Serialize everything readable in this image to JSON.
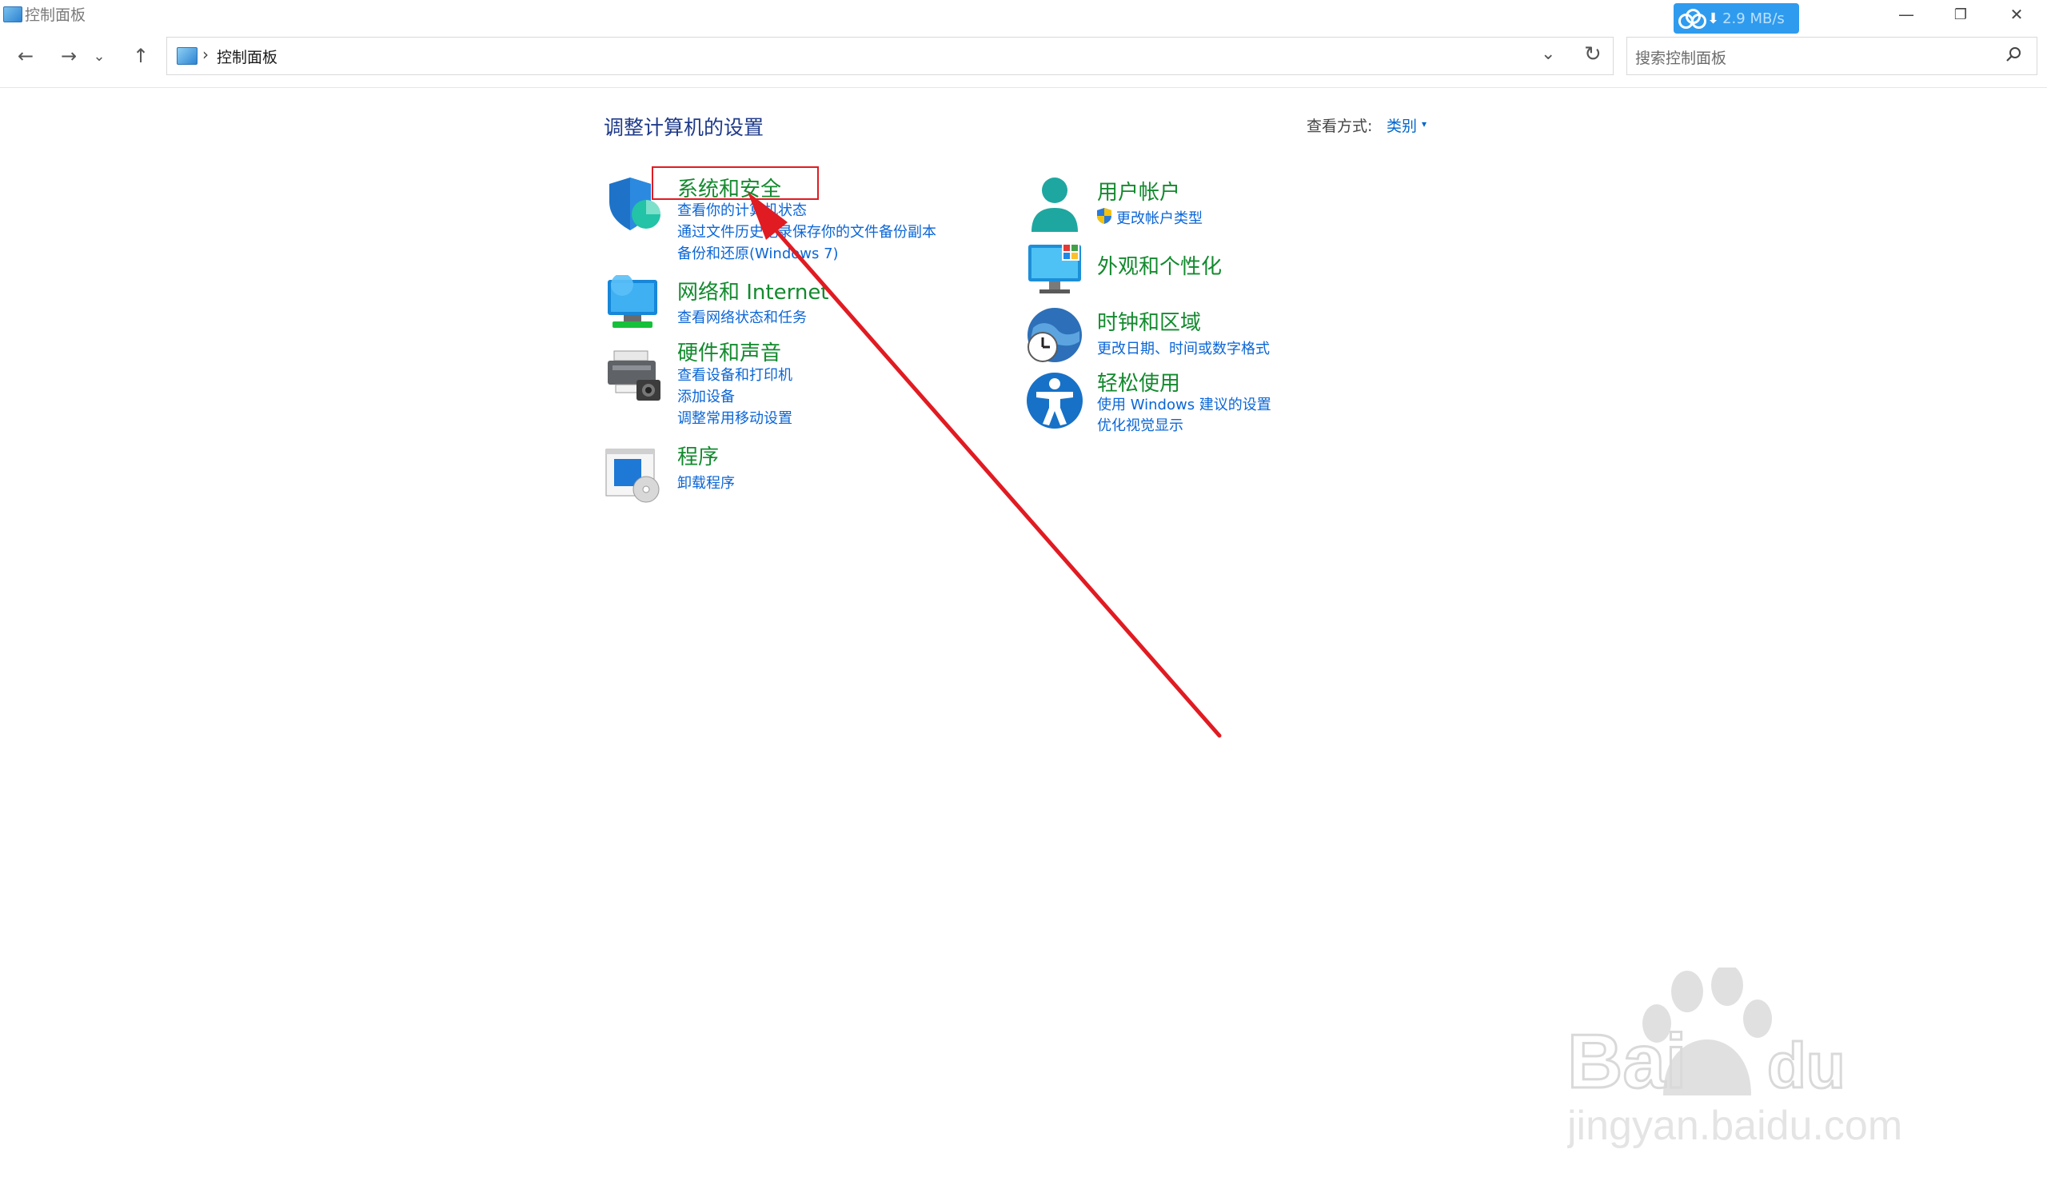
{
  "window": {
    "title": "控制面板",
    "download_speed": "2.9 MB/s",
    "minimize_glyph": "—",
    "restore_glyph": "❐",
    "close_glyph": "✕"
  },
  "nav": {
    "back_glyph": "←",
    "forward_glyph": "→",
    "recent_glyph": "⌄",
    "up_glyph": "↑"
  },
  "address": {
    "separator": "›",
    "path": "控制面板",
    "dropdown_glyph": "⌄",
    "refresh_glyph": "↻"
  },
  "search": {
    "placeholder": "搜索控制面板"
  },
  "main": {
    "heading": "调整计算机的设置",
    "view_by_label": "查看方式:",
    "view_by_value": "类别",
    "view_by_arrow": "▾"
  },
  "categories_left": [
    {
      "icon": "shield-icon",
      "title": "系统和安全",
      "links": [
        "查看你的计算机状态",
        "通过文件历史记录保存你的文件备份副本",
        "备份和还原(Windows 7)"
      ]
    },
    {
      "icon": "network-icon",
      "title": "网络和 Internet",
      "links": [
        "查看网络状态和任务"
      ]
    },
    {
      "icon": "printer-icon",
      "title": "硬件和声音",
      "links": [
        "查看设备和打印机",
        "添加设备",
        "调整常用移动设置"
      ]
    },
    {
      "icon": "programs-icon",
      "title": "程序",
      "links": [
        "卸载程序"
      ]
    }
  ],
  "categories_right": [
    {
      "icon": "user-icon",
      "title": "用户帐户",
      "links": [
        "更改帐户类型"
      ]
    },
    {
      "icon": "monitor-icon",
      "title": "外观和个性化",
      "links": []
    },
    {
      "icon": "clock-globe-icon",
      "title": "时钟和区域",
      "links": [
        "更改日期、时间或数字格式"
      ]
    },
    {
      "icon": "accessibility-icon",
      "title": "轻松使用",
      "links": [
        "使用 Windows 建议的设置",
        "优化视觉显示"
      ]
    }
  ],
  "annotation": {
    "highlight_color": "#e11b22",
    "arrow_color": "#e11b22"
  },
  "watermark": {
    "brand": "Bai du 经验",
    "url": "jingyan.baidu.com"
  }
}
